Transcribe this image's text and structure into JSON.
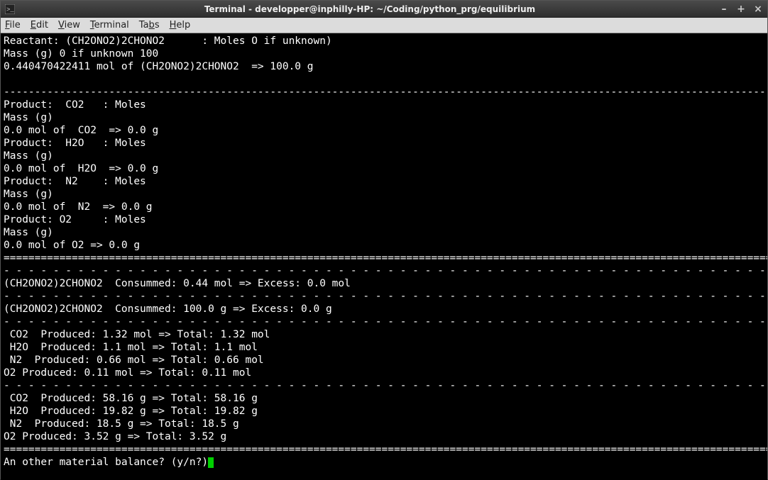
{
  "window": {
    "title": "Terminal - developper@inphilly-HP: ~/Coding/python_prg/equilibrium"
  },
  "menu": {
    "file": "File",
    "edit": "Edit",
    "view": "View",
    "terminal": "Terminal",
    "tabs": "Tabs",
    "help": "Help"
  },
  "lines": {
    "l0": "Reactant: (CH2ONO2)2CHONO2      : Moles O if unknown)",
    "l1": "Mass (g) 0 if unknown 100",
    "l2": "0.440470422411 mol of (CH2ONO2)2CHONO2  => 100.0 g",
    "l3": "",
    "l4": "----------------------------------------------------------------------------------------------------------------------------------",
    "l5": "Product:  CO2   : Moles",
    "l6": "Mass (g)",
    "l7": "0.0 mol of  CO2  => 0.0 g",
    "l8": "Product:  H2O   : Moles",
    "l9": "Mass (g)",
    "l10": "0.0 mol of  H2O  => 0.0 g",
    "l11": "Product:  N2    : Moles",
    "l12": "Mass (g)",
    "l13": "0.0 mol of  N2  => 0.0 g",
    "l14": "Product: O2     : Moles",
    "l15": "Mass (g)",
    "l16": "0.0 mol of O2 => 0.0 g",
    "l17": "==================================================================================================================================",
    "l18": "- - - - - - - - - - - - - - - - - - - - - - - - - - - - - - - - - - - - - - - - - - - - - - - - - - - - - - - - - - - - - - - - - ",
    "l19": "(CH2ONO2)2CHONO2  Consummed: 0.44 mol => Excess: 0.0 mol",
    "l20": "- - - - - - - - - - - - - - - - - - - - - - - - - - - - - - - - - - - - - - - - - - - - - - - - - - - - - - - - - - - - - - - - - ",
    "l21": "(CH2ONO2)2CHONO2  Consummed: 100.0 g => Excess: 0.0 g",
    "l22": "- - - - - - - - - - - - - - - - - - - - - - - - - - - - - - - - - - - - - - - - - - - - - - - - - - - - - - - - - - - - - - - - - ",
    "l23": " CO2  Produced: 1.32 mol => Total: 1.32 mol",
    "l24": " H2O  Produced: 1.1 mol => Total: 1.1 mol",
    "l25": " N2  Produced: 0.66 mol => Total: 0.66 mol",
    "l26": "O2 Produced: 0.11 mol => Total: 0.11 mol",
    "l27": "- - - - - - - - - - - - - - - - - - - - - - - - - - - - - - - - - - - - - - - - - - - - - - - - - - - - - - - - - - - - - - - - - ",
    "l28": " CO2  Produced: 58.16 g => Total: 58.16 g",
    "l29": " H2O  Produced: 19.82 g => Total: 19.82 g",
    "l30": " N2  Produced: 18.5 g => Total: 18.5 g",
    "l31": "O2 Produced: 3.52 g => Total: 3.52 g",
    "l32": "==================================================================================================================================",
    "l33": "An other material balance? (y/n?)"
  }
}
